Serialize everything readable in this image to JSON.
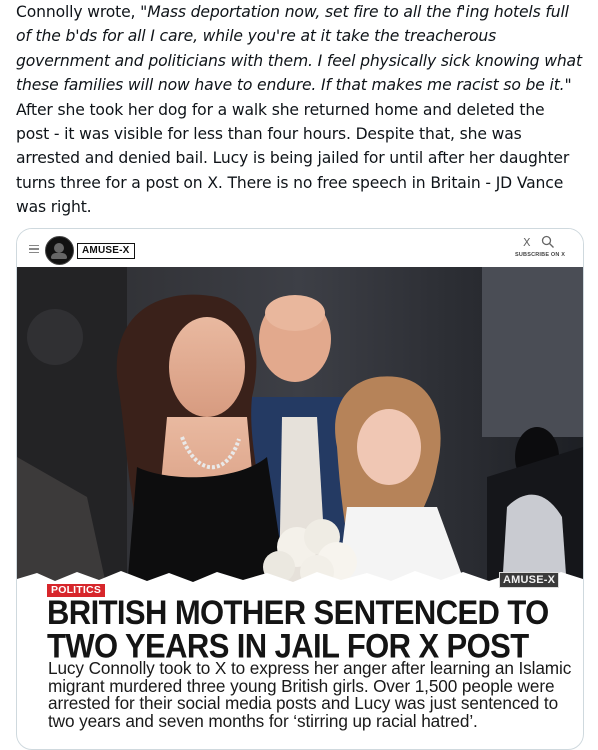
{
  "post": {
    "lead": "Connolly wrote, ",
    "quote": "\"Mass deportation now, set fire to all the f'ing hotels full of the b'ds for all I care, while you're at it take the treacherous government and politicians with them. I feel physically sick knowing what these families will now have to endure. If that makes me racist so be it.\"",
    "rest": " After she took her dog for a walk she returned home and deleted the post - it was visible for less than four hours. Despite that, she was arrested and denied bail. Lucy is being jailed for until after her daughter turns three for a post on X. There is no free speech in Britain - JD Vance was right."
  },
  "card": {
    "brand": "AMUSE-X",
    "top_x": "X",
    "subscribe": "SUBSCRIBE ON X",
    "photo_badge": "AMUSE-X",
    "category": "POLITICS",
    "headline": "BRITISH MOTHER SENTENCED TO TWO YEARS IN JAIL FOR X POST",
    "summary": "Lucy Connolly took to X to express her anger after learning an Islamic migrant murdered three young British girls. Over 1,500 people were arrested for their social media posts and Lucy was just sentenced to two years and seven months for ‘stirring up racial hatred’."
  },
  "icons": {
    "menu": "hamburger-menu-icon",
    "logo": "amuse-logo-icon",
    "close": "x-logo-icon",
    "search": "search-icon"
  }
}
